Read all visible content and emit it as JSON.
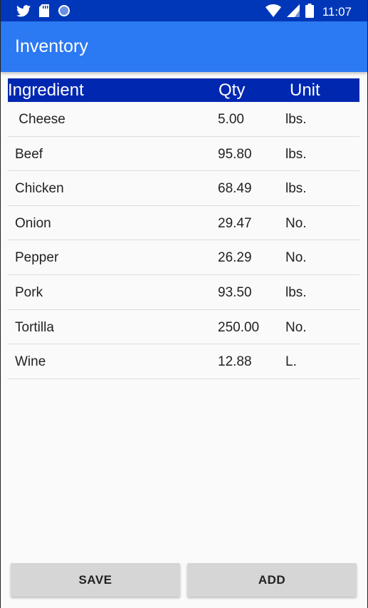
{
  "status_bar": {
    "icons": [
      "twitter-icon",
      "sd-card-icon",
      "sync-circle-icon",
      "wifi-icon",
      "signal-icon",
      "battery-icon"
    ],
    "time": "11:07"
  },
  "app_bar": {
    "title": "Inventory"
  },
  "table": {
    "headers": {
      "ingredient": "Ingredient",
      "qty": "Qty",
      "unit": "Unit"
    },
    "rows": [
      {
        "name": " Cheese",
        "qty": "5.00",
        "unit": "lbs."
      },
      {
        "name": "Beef",
        "qty": "95.80",
        "unit": "lbs."
      },
      {
        "name": "Chicken",
        "qty": "68.49",
        "unit": "lbs."
      },
      {
        "name": "Onion",
        "qty": "29.47",
        "unit": "No."
      },
      {
        "name": "Pepper",
        "qty": "26.29",
        "unit": "No."
      },
      {
        "name": "Pork",
        "qty": "93.50",
        "unit": "lbs."
      },
      {
        "name": "Tortilla",
        "qty": "250.00",
        "unit": "No."
      },
      {
        "name": "Wine",
        "qty": "12.88",
        "unit": "L."
      }
    ]
  },
  "actions": {
    "save_label": "SAVE",
    "add_label": "ADD"
  },
  "colors": {
    "status_bar": "#0037b8",
    "app_bar": "#2b79f3",
    "table_header": "#0027b0",
    "button": "#d6d6d6"
  }
}
